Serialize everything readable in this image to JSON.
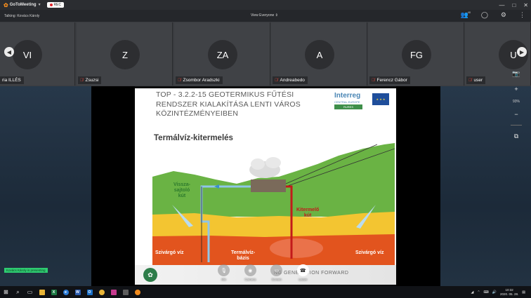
{
  "window": {
    "app_name": "GoToMeeting",
    "rec_label": "REC",
    "controls": [
      "—",
      "□",
      "✕"
    ]
  },
  "infobar": {
    "talking": "Talking: Kovács Károly",
    "view": "View Everyone",
    "participant_count": "40"
  },
  "participants": [
    {
      "initials": "VI",
      "name": "ria ILLÉS",
      "muted": false
    },
    {
      "initials": "Z",
      "name": "Zsuzsi",
      "muted": true
    },
    {
      "initials": "ZA",
      "name": "Zsombor Aradszki",
      "muted": true
    },
    {
      "initials": "A",
      "name": "Andreabedo",
      "muted": true
    },
    {
      "initials": "FG",
      "name": "Ferencz Gábor",
      "muted": true
    },
    {
      "initials": "U",
      "name": "user",
      "muted": true
    }
  ],
  "slide": {
    "title_line1": "TOP - 3.2.2-15 GEOTERMIKUS FŰTÉSI",
    "title_line2": "RENDSZER KIALAKÍTÁSA LENTI VÁROS",
    "title_line3": "KÖZINTÉZMÉNYEIBEN",
    "logo_main": "Interreg",
    "logo_sub": "CENTRAL EUROPE",
    "logo_project": "RURES",
    "heading": "Termálvíz-kitermelés",
    "labels": {
      "reinjection_line1": "Vissza-",
      "reinjection_line2": "sajtoló",
      "reinjection_line3": "kút",
      "production_line1": "Kitermelő",
      "production_line2": "kút",
      "seep_left": "Szivárgó víz",
      "seep_right": "Szivárgó víz",
      "base_line1": "Termálvíz-",
      "base_line2": "bázis"
    },
    "footer_text": "NG GENERATION FORWARD"
  },
  "presenting": "Kovács Károly is presenting",
  "toolbar": {
    "mic": "Mic",
    "camera": "Camera",
    "screen": "Screen",
    "leave": "Leave"
  },
  "side_controls": {
    "zoom": "93%"
  },
  "taskbar": {
    "time": "10:32",
    "date": "2020. 05. 28."
  },
  "colors": {
    "accent_orange": "#f28c1e",
    "muted_red": "#e8493c",
    "presenting_green": "#2ecc71",
    "hill_green": "#6ab344",
    "layer_yellow": "#f3c531",
    "layer_orange": "#e2541e"
  }
}
